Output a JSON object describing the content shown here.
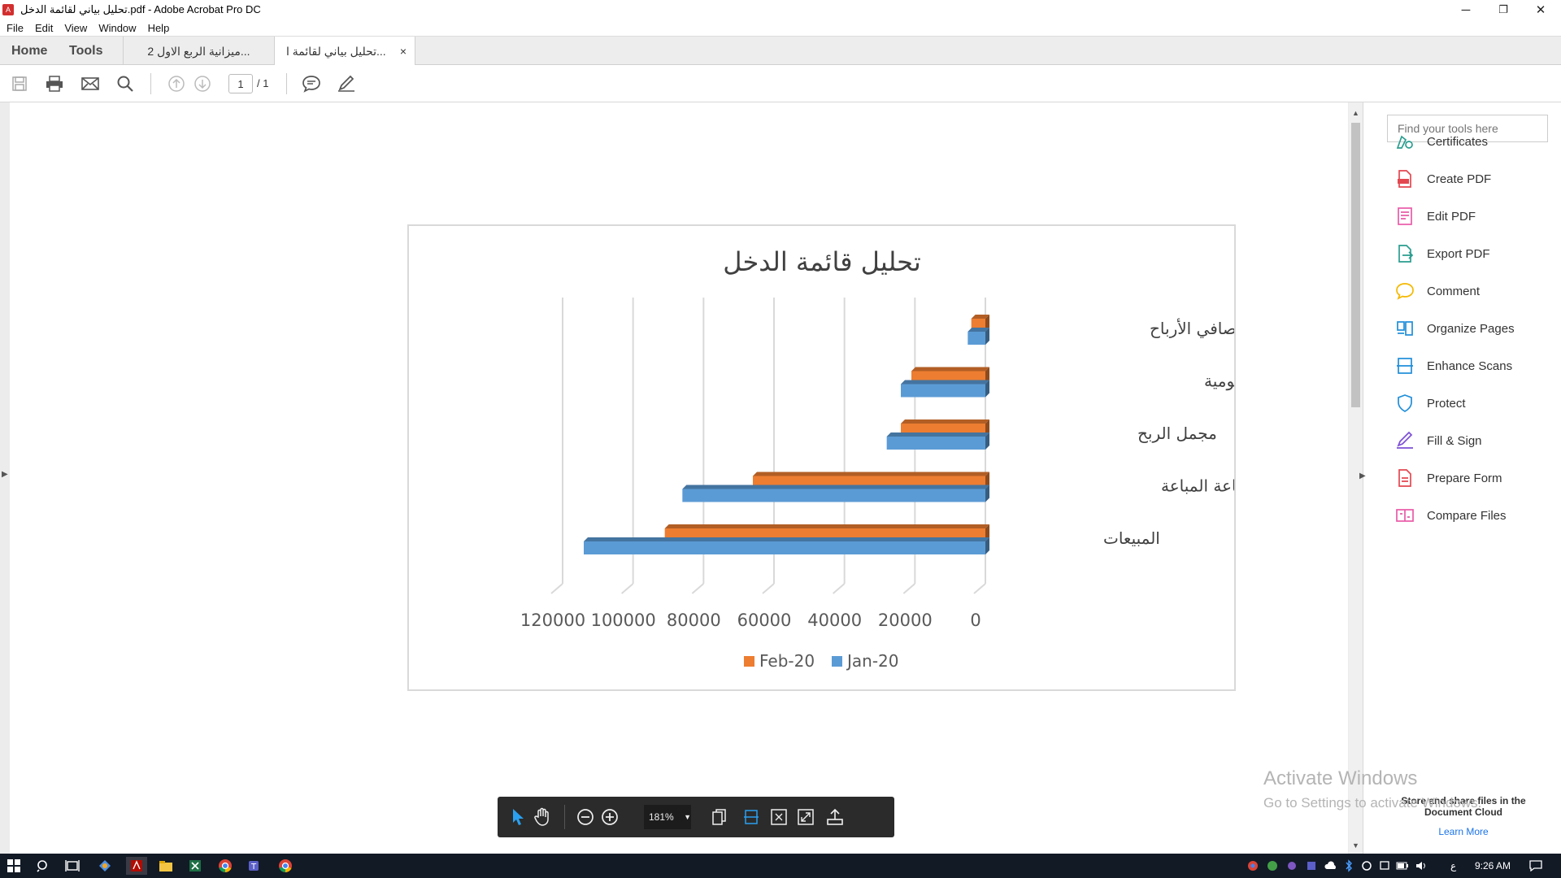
{
  "window": {
    "title": "تحليل بياني لقائمة الدخل.pdf - Adobe Acrobat Pro DC",
    "minimize": "─",
    "restore": "❐",
    "close": "✕"
  },
  "menu": [
    "File",
    "Edit",
    "View",
    "Window",
    "Help"
  ],
  "tabs": {
    "home": "Home",
    "tools": "Tools",
    "docs": [
      {
        "label": "ميزانية الربع الاول 2..."
      },
      {
        "label": "تحليل بياني لقائمة ا..."
      }
    ],
    "close": "×"
  },
  "toolbar": {
    "page_current": "1",
    "page_total": "/ 1"
  },
  "chart_data": {
    "type": "bar",
    "orientation": "horizontal",
    "title": "تحليل قائمة الدخل",
    "categories": [
      "صافي الأرباح",
      "المصاريف الإدارية والعمومية",
      "مجمل الربح",
      "تكلفة البضاعة المباعة",
      "المبيعات"
    ],
    "series": [
      {
        "name": "Feb-20",
        "color": "#ed7d31",
        "values": [
          4000,
          21000,
          24000,
          66000,
          91000
        ]
      },
      {
        "name": "Jan-20",
        "color": "#5b9bd5",
        "values": [
          5000,
          24000,
          28000,
          86000,
          114000
        ]
      }
    ],
    "xlim": [
      0,
      120000
    ],
    "x_ticks": [
      "0",
      "20000",
      "40000",
      "60000",
      "80000",
      "100000",
      "120000"
    ],
    "x_direction": "reversed",
    "legend": [
      {
        "name": "Feb-20",
        "color": "#ed7d31"
      },
      {
        "name": "Jan-20",
        "color": "#5b9bd5"
      }
    ],
    "legend_position": "bottom",
    "grid": true
  },
  "tools_pane": {
    "search_placeholder": "Find your tools here",
    "items": [
      {
        "label": "Certificates",
        "icon": "certificate-icon",
        "color": "#2a9d8f"
      },
      {
        "label": "Create PDF",
        "icon": "create-pdf-icon",
        "color": "#e34850"
      },
      {
        "label": "Edit PDF",
        "icon": "edit-pdf-icon",
        "color": "#e85ba8"
      },
      {
        "label": "Export PDF",
        "icon": "export-pdf-icon",
        "color": "#2a9d8f"
      },
      {
        "label": "Comment",
        "icon": "comment-icon",
        "color": "#f5b800"
      },
      {
        "label": "Organize Pages",
        "icon": "organize-pages-icon",
        "color": "#1f8ed9"
      },
      {
        "label": "Enhance Scans",
        "icon": "enhance-scans-icon",
        "color": "#1f8ed9"
      },
      {
        "label": "Protect",
        "icon": "protect-shield-icon",
        "color": "#1f8ed9"
      },
      {
        "label": "Fill & Sign",
        "icon": "fill-sign-icon",
        "color": "#7d4fd6"
      },
      {
        "label": "Prepare Form",
        "icon": "prepare-form-icon",
        "color": "#e34850"
      },
      {
        "label": "Compare Files",
        "icon": "compare-files-icon",
        "color": "#e85ba8"
      }
    ],
    "cloud_promo": "Store and share files in the Document Cloud",
    "learn_more": "Learn More"
  },
  "watermark": {
    "activate_title": "Activate Windows",
    "activate_sub": "Go to Settings to activate Windows."
  },
  "floating_toolbar": {
    "zoom": "181%"
  },
  "taskbar": {
    "lang": "ع",
    "time": "9:26 AM"
  }
}
